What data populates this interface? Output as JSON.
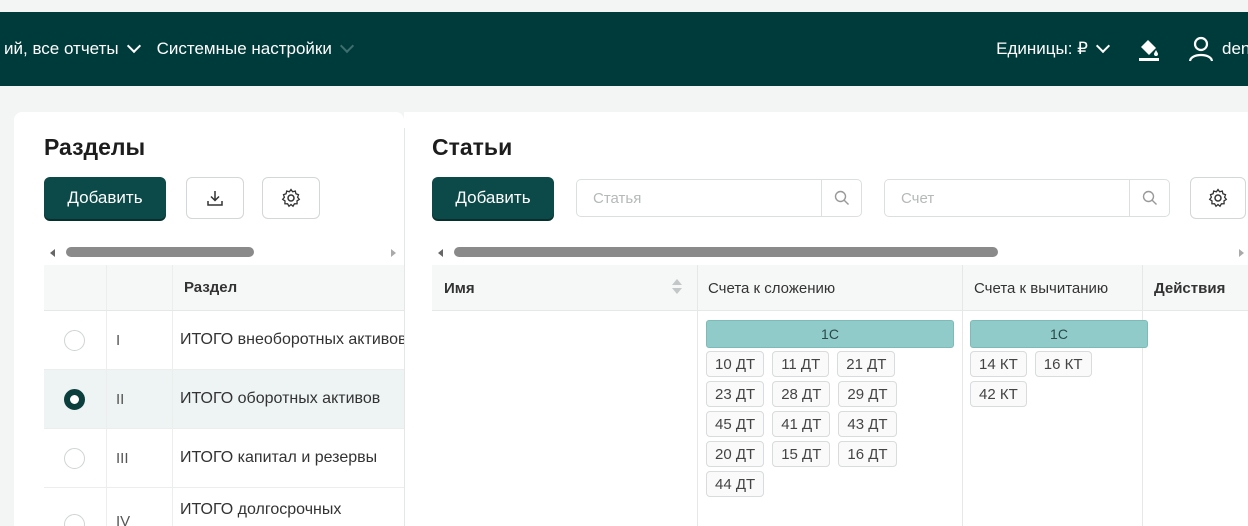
{
  "topbar": {
    "menu": [
      {
        "label": "ий, все отчеты"
      },
      {
        "label": "Системные настройки"
      }
    ],
    "units_label": "Единицы: ₽",
    "user_name": "den"
  },
  "sections": {
    "title": "Разделы",
    "add_label": "Добавить",
    "column_header": "Раздел",
    "rows": [
      {
        "num": "I",
        "name": "ИТОГО внеоборотных активов",
        "selected": false
      },
      {
        "num": "II",
        "name": "ИТОГО оборотных активов",
        "selected": true
      },
      {
        "num": "III",
        "name": "ИТОГО капитал и резервы",
        "selected": false
      },
      {
        "num": "IV",
        "name": "ИТОГО долгосрочных",
        "selected": false
      }
    ]
  },
  "articles": {
    "title": "Статьи",
    "add_label": "Добавить",
    "search_article_placeholder": "Статья",
    "search_account_placeholder": "Счет",
    "columns": {
      "name": "Имя",
      "add_accounts": "Счета к сложению",
      "sub_accounts": "Счета к вычитанию",
      "actions": "Действия"
    },
    "add_group": {
      "label": "1С",
      "tags": [
        "10 ДТ",
        "11 ДТ",
        "21 ДТ",
        "23 ДТ",
        "28 ДТ",
        "29 ДТ",
        "45 ДТ",
        "41 ДТ",
        "43 ДТ",
        "20 ДТ",
        "15 ДТ",
        "16 ДТ",
        "44 ДТ"
      ]
    },
    "sub_group": {
      "label": "1С",
      "tags": [
        "14 КТ",
        "16 КТ",
        "42 КТ"
      ]
    }
  },
  "colors": {
    "topbar": "#003b3b",
    "primary_button": "#0b4a48",
    "group_header": "#90cbc9"
  }
}
